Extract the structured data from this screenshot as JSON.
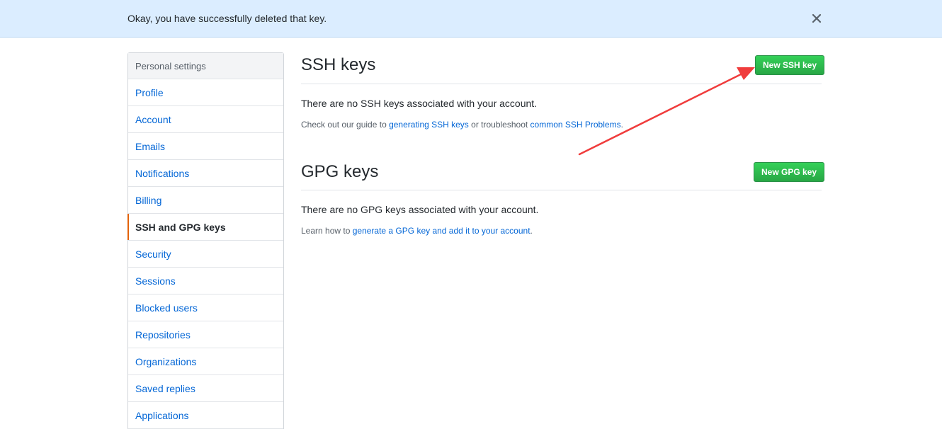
{
  "flash": {
    "message": "Okay, you have successfully deleted that key."
  },
  "sidebar": {
    "header": "Personal settings",
    "items": [
      {
        "label": "Profile"
      },
      {
        "label": "Account"
      },
      {
        "label": "Emails"
      },
      {
        "label": "Notifications"
      },
      {
        "label": "Billing"
      },
      {
        "label": "SSH and GPG keys",
        "selected": true
      },
      {
        "label": "Security"
      },
      {
        "label": "Sessions"
      },
      {
        "label": "Blocked users"
      },
      {
        "label": "Repositories"
      },
      {
        "label": "Organizations"
      },
      {
        "label": "Saved replies"
      },
      {
        "label": "Applications"
      }
    ]
  },
  "ssh": {
    "title": "SSH keys",
    "button": "New SSH key",
    "blank": "There are no SSH keys associated with your account.",
    "help_prefix": "Check out our guide to ",
    "help_link1": "generating SSH keys",
    "help_middle": " or troubleshoot ",
    "help_link2": "common SSH Problems",
    "help_suffix": "."
  },
  "gpg": {
    "title": "GPG keys",
    "button": "New GPG key",
    "blank": "There are no GPG keys associated with your account.",
    "help_prefix": "Learn how to ",
    "help_link": "generate a GPG key and add it to your account",
    "help_suffix": "."
  },
  "colors": {
    "flash_bg": "#dbedff",
    "link": "#0366d6",
    "primary_button": "#28a745",
    "selected_marker": "#e36209",
    "annotation_arrow": "#f03c3c"
  },
  "icons": {
    "flash_close": "close-icon"
  }
}
